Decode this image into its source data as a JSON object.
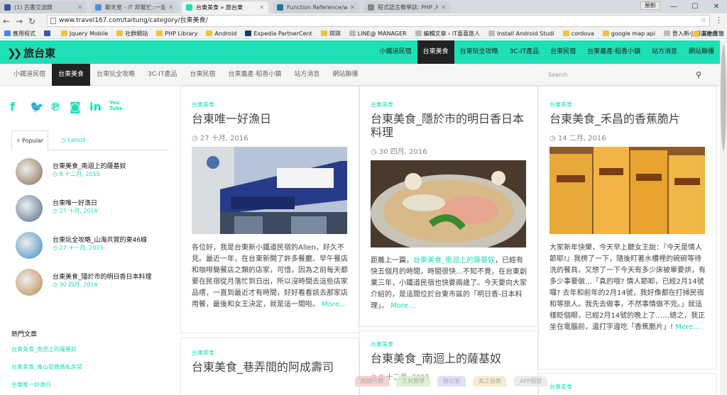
{
  "browser": {
    "tabs": [
      {
        "title": "(1) 古書交流館",
        "color": "#3b5998",
        "active": false
      },
      {
        "title": "聊天室 - iT 邦幫忙::一起幫",
        "color": "#4a90d9",
        "active": false
      },
      {
        "title": "台東美食 » 旅台東",
        "color": "#1de0b6",
        "active": true
      },
      {
        "title": "Function Reference/wp",
        "color": "#21759b",
        "active": false
      },
      {
        "title": "程式語言教學誌: PHP 入",
        "color": "#888888",
        "active": false
      }
    ],
    "user_chip": "屋齡",
    "url": "www.travel167.com/taitung/category/台東美食/",
    "bookmarks": [
      {
        "label": "應用程式",
        "kind": "apps"
      },
      {
        "label": "",
        "kind": "fb"
      },
      {
        "label": "Jquery Mobile",
        "kind": "folder"
      },
      {
        "label": "社群網站",
        "kind": "folder"
      },
      {
        "label": "PHP Library",
        "kind": "folder"
      },
      {
        "label": "Android",
        "kind": "folder"
      },
      {
        "label": "Expedia PartnerCent",
        "kind": "expedia"
      },
      {
        "label": "琪琪",
        "kind": "folder"
      },
      {
        "label": "LINE@ MANAGER",
        "kind": "page"
      },
      {
        "label": "編輯文章 ‹ iT喜喜旅人",
        "kind": "page"
      },
      {
        "label": "Install Android Studi",
        "kind": "page"
      },
      {
        "label": "cordova",
        "kind": "folder"
      },
      {
        "label": "google map api",
        "kind": "folder"
      },
      {
        "label": "登入新小鐵道後台",
        "kind": "page"
      }
    ],
    "bookmarks_more": "»",
    "bookmarks_other": "其他書籤"
  },
  "site": {
    "logo": "旅台東",
    "main_nav": [
      "小鐵道民宿",
      "台東美食",
      "台東玩全攻略",
      "3C-IT產品",
      "台東民宿",
      "台東農產·稻香小鎮",
      "站方消息",
      "網站聯播"
    ],
    "main_nav_active": 1,
    "sub_nav": [
      "小鐵道民宿",
      "台東美食",
      "台東玩全攻略",
      "3C-IT產品",
      "台東民宿",
      "台東農產·稻香小鎮",
      "站方消息",
      "網站聯播"
    ],
    "sub_nav_active": 1,
    "search_placeholder": "Search"
  },
  "sidebar": {
    "social": [
      "f",
      "twitter",
      "pinterest",
      "instagram",
      "in",
      "YouTube"
    ],
    "tab_popular": "Popular",
    "tab_latest": "Latest",
    "popular": [
      {
        "title": "台東美食_南迴上的薩基奴",
        "date": "8 十二月, 2015"
      },
      {
        "title": "台東唯一好漁日",
        "date": "27 十月, 2016"
      },
      {
        "title": "台東玩全攻略_山海共賞的東46線",
        "date": "27 十一月, 2015"
      },
      {
        "title": "台東美食_隱於市的明日香日本料理",
        "date": "30 四月, 2016"
      }
    ],
    "hot_heading": "熱門文章",
    "hot": [
      "台東美食_南迴上的薩基奴",
      "台東美食_後山發媽媽私房菜",
      "台東唯一好漁日"
    ]
  },
  "posts": [
    {
      "category": "台東美食",
      "title": "台東唯一好漁日",
      "date": "27 十月, 2016",
      "excerpt": "各位好，我是台東新小鐵道民宿的Allen，好久不見。最近一年，在台東新開了許多餐廳、早午餐店和咖啡簡餐店之類的店家，可惜，因為之前每天都要在民宿從月落忙到日出，所以沒時間去這些店家品嚐，一直到最近才有時間，好好看看該去那家店用餐，最後和女王決定，就是這一間啦。",
      "more": "More…"
    },
    {
      "category": "台東美食",
      "title": "台東美食_隱於市的明日香日本料理",
      "date": "30 四月, 2016",
      "excerpt_pre": "距離上一篇，",
      "excerpt_link": "台東美食_南迴上的薩基奴",
      "excerpt": "，已經有快五個月的時間，時間很快…不知不覺，在台東創業三年，小鐵道民宿也快要兩歲了。今天要向大家介紹的，是這間位於台東市區的「明日香-日本料理」。",
      "more": "More…"
    },
    {
      "category": "台東美食",
      "title": "台東美食_禾昌的香蕉脆片",
      "date": "14 二月, 2016",
      "excerpt": "大家新年快樂，今天早上聽女王說：『今天是情人節耶!』我楞了一下，隨後盯著水槽裡的碗碗等待洗的餐具，又想了一下今天有多少床被單要烘，有多少事要做…「真的哦? 情人節耶，已經2月14號囉? 去年和前年的2月14號，我好像都在打掃民宿和等旅人。我先去做事，不然事情做不完。」就這樣眨個眼，已經2月14號的晚上了……總之，我正坐在電腦前，邊打字邊吃「香蕉脆片」!",
      "more": "More…"
    },
    {
      "category": "台東美食",
      "title": "台東美食_巷弄間的阿成壽司",
      "date": ""
    },
    {
      "category": "台東美食",
      "title": "台東美食_南迴上的薩基奴",
      "date": "8 十二月, 2015"
    },
    {
      "category": "台東美食",
      "title": "",
      "date": ""
    }
  ],
  "footer_tags": [
    "網路行銷",
    "工具教學",
    "辦公室",
    "美工音樂",
    "APP開發"
  ]
}
